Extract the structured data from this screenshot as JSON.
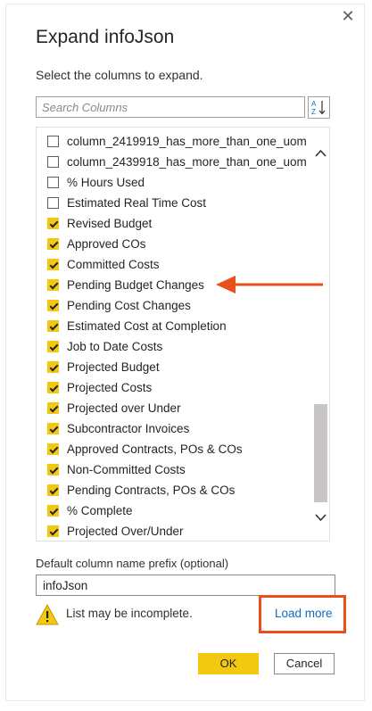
{
  "dialog": {
    "title": "Expand infoJson",
    "subtitle": "Select the columns to expand.",
    "close_icon": "close-icon"
  },
  "search": {
    "placeholder": "Search Columns",
    "value": ""
  },
  "sort_button": {
    "icon": "sort-az-icon"
  },
  "columns": [
    {
      "label": "column_2419919_has_more_than_one_uom",
      "checked": false
    },
    {
      "label": "column_2439918_has_more_than_one_uom",
      "checked": false
    },
    {
      "label": "% Hours Used",
      "checked": false
    },
    {
      "label": "Estimated Real Time Cost",
      "checked": false
    },
    {
      "label": "Revised Budget",
      "checked": true
    },
    {
      "label": "Approved COs",
      "checked": true
    },
    {
      "label": "Committed Costs",
      "checked": true
    },
    {
      "label": "Pending Budget Changes",
      "checked": true
    },
    {
      "label": "Pending Cost Changes",
      "checked": true
    },
    {
      "label": "Estimated Cost at Completion",
      "checked": true
    },
    {
      "label": "Job to Date Costs",
      "checked": true
    },
    {
      "label": "Projected Budget",
      "checked": true
    },
    {
      "label": "Projected Costs",
      "checked": true
    },
    {
      "label": "Projected over Under",
      "checked": true
    },
    {
      "label": "Subcontractor Invoices",
      "checked": true
    },
    {
      "label": "Approved Contracts, POs & COs",
      "checked": true
    },
    {
      "label": "Non-Committed Costs",
      "checked": true
    },
    {
      "label": "Pending Contracts, POs & COs",
      "checked": true
    },
    {
      "label": "% Complete",
      "checked": true
    },
    {
      "label": "Projected Over/Under",
      "checked": true
    }
  ],
  "prefix": {
    "label": "Default column name prefix (optional)",
    "value": "infoJson"
  },
  "warning": {
    "icon": "warning-icon",
    "text": "List may be incomplete."
  },
  "load_more_label": "Load more",
  "buttons": {
    "ok": "OK",
    "cancel": "Cancel"
  },
  "colors": {
    "accent": "#f2c811",
    "annotation": "#ea4e1b",
    "link": "#0f6cbd"
  }
}
